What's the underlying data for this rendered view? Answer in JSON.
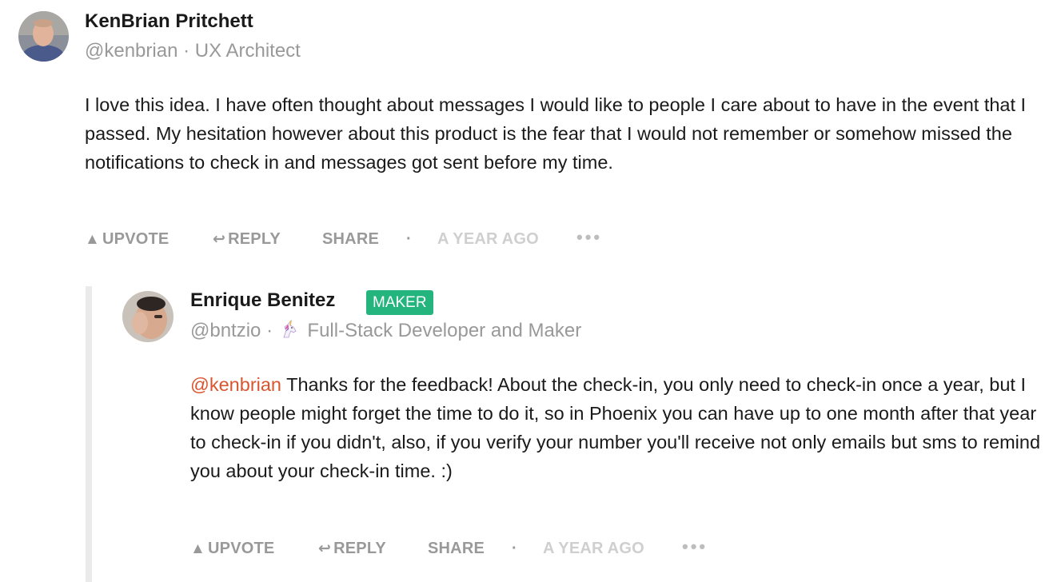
{
  "comments": [
    {
      "author": {
        "name": "KenBrian Pritchett",
        "handle": "@kenbrian",
        "separator": "·",
        "headline": "UX Architect"
      },
      "body": "I love this idea. I have often thought about messages I would like to people I care about to have in the event that I passed. My hesitation however about this product is the fear that I would not remember or somehow missed the notifications to check in and messages got sent before my time.",
      "actions": {
        "upvote": "UPVOTE",
        "reply": "REPLY",
        "share": "SHARE",
        "dot": "·",
        "time": "A YEAR AGO",
        "more": "•••"
      }
    },
    {
      "author": {
        "name": "Enrique Benitez",
        "badge": "MAKER",
        "handle": "@bntzio",
        "separator": "·",
        "headline": "Full-Stack Developer and Maker"
      },
      "mention": "@kenbrian",
      "body": " Thanks for the feedback! About the check-in, you only need to check-in once a year, but I know people might forget the time to do it, so in Phoenix you can have up to one month after that year to check-in if you didn't, also, if you verify your number you'll receive not only emails but sms to remind you about your check-in time. :)",
      "actions": {
        "upvote": "UPVOTE",
        "reply": "REPLY",
        "share": "SHARE",
        "dot": "·",
        "time": "A YEAR AGO",
        "more": "•••"
      }
    }
  ],
  "icons": {
    "upvote": "triangle-up-icon",
    "reply": "reply-arrow-icon",
    "unicorn": "unicorn-icon"
  },
  "colors": {
    "maker_badge": "#24b47e",
    "mention": "#da552f",
    "muted": "#999999",
    "timestamp": "#cfcfcf"
  }
}
